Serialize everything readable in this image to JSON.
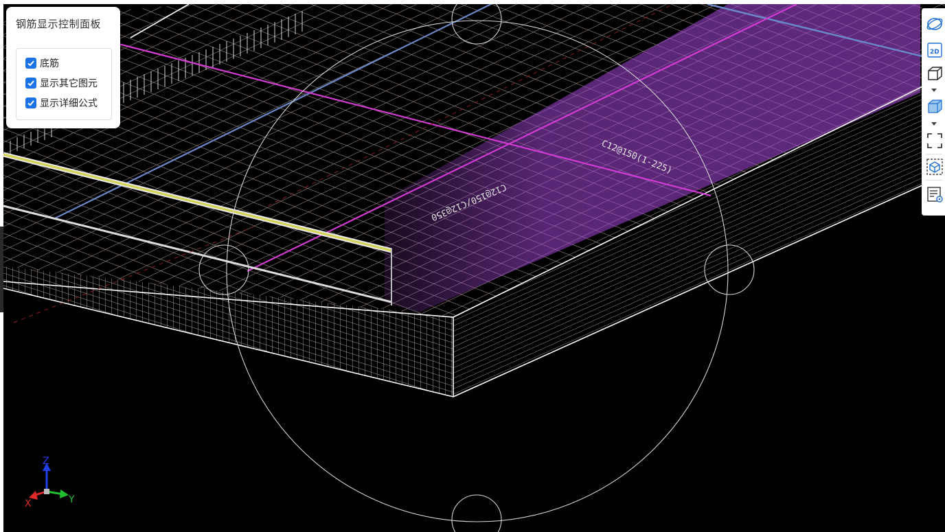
{
  "panel": {
    "title": "钢筋显示控制面板",
    "options": [
      {
        "label": "底筋",
        "checked": true
      },
      {
        "label": "显示其它图元",
        "checked": true
      },
      {
        "label": "显示详细公式",
        "checked": true
      }
    ]
  },
  "viewport": {
    "annotations": {
      "label_a": "C12@150(1-225)",
      "label_b": "C12@150/C12@350"
    }
  },
  "toolbar": {
    "buttons": [
      {
        "name": "orbit-icon"
      },
      {
        "name": "view-2d-icon",
        "text": "2D"
      },
      {
        "name": "view-3d-wire-icon"
      },
      {
        "name": "view-3d-solid-icon"
      },
      {
        "name": "fit-view-icon"
      },
      {
        "name": "element-view-icon"
      },
      {
        "name": "formula-list-icon"
      }
    ]
  },
  "axis": {
    "x": "X",
    "y": "Y",
    "z": "Z"
  },
  "colors": {
    "background": "#000000",
    "mesh": "#b9a9a0",
    "highlight": "#a046d2",
    "blue_line": "#6a88c8",
    "magenta_line": "#d23cd2",
    "checkbox": "#1c73e8"
  }
}
